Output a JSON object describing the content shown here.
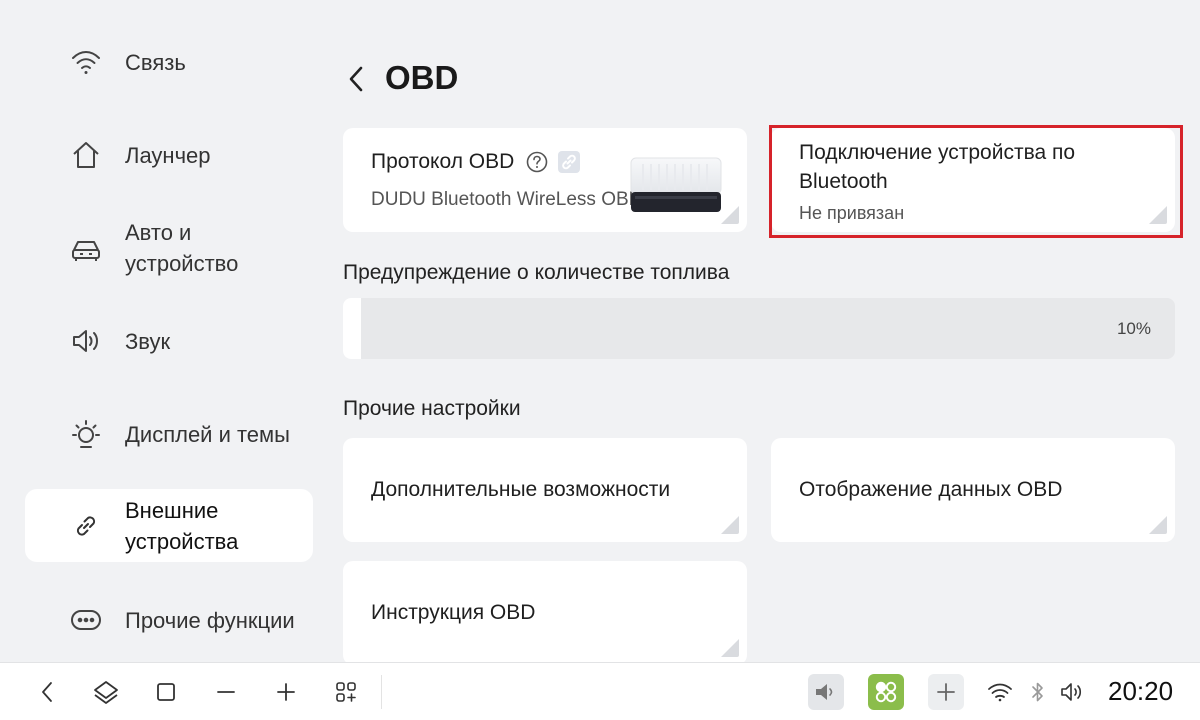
{
  "sidebar": {
    "items": [
      {
        "label": "Связь",
        "icon": "wifi-icon",
        "active": false
      },
      {
        "label": "Лаунчер",
        "icon": "home-icon",
        "active": false
      },
      {
        "label": "Авто и устройство",
        "icon": "car-icon",
        "active": false
      },
      {
        "label": "Звук",
        "icon": "speaker-icon",
        "active": false
      },
      {
        "label": "Дисплей и темы",
        "icon": "brightness-icon",
        "active": false
      },
      {
        "label": "Внешние устройства",
        "icon": "link-icon",
        "active": true
      },
      {
        "label": "Прочие функции",
        "icon": "more-icon",
        "active": false
      }
    ]
  },
  "header": {
    "title": "OBD",
    "back_icon": "chevron-left-icon"
  },
  "obd_protocol": {
    "title": "Протокол OBD",
    "subtitle": "DUDU Bluetooth WireLess OBD"
  },
  "bluetooth_connection": {
    "title": "Подключение устройства по Bluetooth",
    "status": "Не привязан"
  },
  "fuel_warning": {
    "heading": "Предупреждение о количестве топлива",
    "value_label": "10%",
    "value": 10
  },
  "other_settings": {
    "heading": "Прочие настройки",
    "extra_features": "Дополнительные возможности",
    "obd_display": "Отображение данных OBD",
    "obd_guide": "Инструкция OBD"
  },
  "taskbar": {
    "time": "20:20",
    "left_icons": [
      "back-icon",
      "home-icon",
      "recents-icon",
      "minus-icon",
      "plus-icon",
      "apps-grid-icon"
    ],
    "right_icons": [
      "volume-tile-icon",
      "app-tile-icon",
      "add-tile-icon",
      "wifi-icon",
      "bluetooth-icon",
      "volume-icon"
    ]
  },
  "colors": {
    "background": "#f1f2f4",
    "card": "#ffffff",
    "highlight": "#d6232a",
    "app_tile": "#8bbd4b"
  }
}
